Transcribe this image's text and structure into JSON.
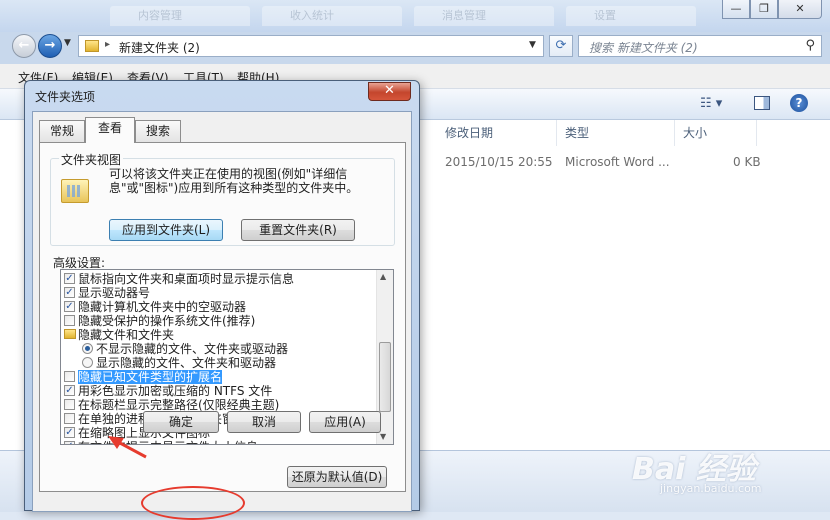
{
  "explorer": {
    "ghost_tabs": [
      "内容管理",
      "收入统计",
      "消息管理",
      "设置"
    ],
    "address": "新建文件夹 (2)",
    "search_placeholder": "搜索 新建文件夹 (2)",
    "menu": [
      "文件(F)",
      "编辑(E)",
      "查看(V)",
      "工具(T)",
      "帮助(H)"
    ],
    "columns": [
      "修改日期",
      "类型",
      "大小"
    ],
    "file_row": {
      "modified": "2015/10/15 20:55",
      "type": "Microsoft Word ...",
      "size": "0 KB"
    }
  },
  "dialog": {
    "title": "文件夹选项",
    "tabs": [
      "常规",
      "查看",
      "搜索"
    ],
    "active_tab": "查看",
    "group_title": "文件夹视图",
    "group_desc": "可以将该文件夹正在使用的视图(例如\"详细信息\"或\"图标\")应用到所有这种类型的文件夹中。",
    "apply_to_folders": "应用到文件夹(L)",
    "reset_folders": "重置文件夹(R)",
    "advanced_label": "高级设置:",
    "settings": [
      {
        "kind": "checkbox",
        "checked": true,
        "label": "鼠标指向文件夹和桌面项时显示提示信息"
      },
      {
        "kind": "checkbox",
        "checked": true,
        "label": "显示驱动器号"
      },
      {
        "kind": "checkbox",
        "checked": true,
        "label": "隐藏计算机文件夹中的空驱动器"
      },
      {
        "kind": "checkbox",
        "checked": false,
        "label": "隐藏受保护的操作系统文件(推荐)"
      },
      {
        "kind": "folder",
        "label": "隐藏文件和文件夹"
      },
      {
        "kind": "radio",
        "checked": true,
        "label": "不显示隐藏的文件、文件夹或驱动器"
      },
      {
        "kind": "radio",
        "checked": false,
        "label": "显示隐藏的文件、文件夹和驱动器"
      },
      {
        "kind": "checkbox",
        "checked": false,
        "selected": true,
        "label": "隐藏已知文件类型的扩展名"
      },
      {
        "kind": "checkbox",
        "checked": true,
        "label": "用彩色显示加密或压缩的 NTFS 文件"
      },
      {
        "kind": "checkbox",
        "checked": false,
        "label": "在标题栏显示完整路径(仅限经典主题)"
      },
      {
        "kind": "checkbox",
        "checked": false,
        "label": "在单独的进程中打开文件夹窗口"
      },
      {
        "kind": "checkbox",
        "checked": true,
        "label": "在缩略图上显示文件图标"
      },
      {
        "kind": "checkbox",
        "checked": true,
        "label": "在文件夹提示中显示文件大小信息"
      }
    ],
    "restore_defaults": "还原为默认值(D)",
    "ok": "确定",
    "cancel": "取消",
    "apply": "应用(A)"
  },
  "watermark": {
    "brand": "Bai 经验",
    "url": "jingyan.baidu.com"
  },
  "colors": {
    "highlight": "#3399ff",
    "annotation": "#e63b2e",
    "close_button": "#c4462d"
  }
}
